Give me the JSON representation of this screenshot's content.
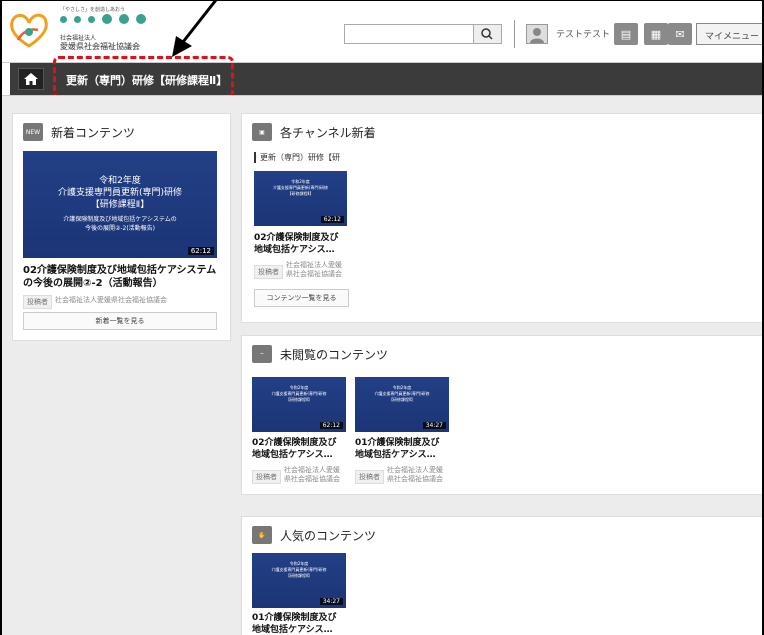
{
  "header": {
    "logo_tagline": "「やさしさ」を創造しあおう",
    "logo_org_type": "社会福祉法人",
    "logo_org_name": "愛媛県社会福祉協議会",
    "search_placeholder": "",
    "user_name": "テストテスト",
    "my_menu_label": "マイメニュー"
  },
  "nav": {
    "title": "更新（専門）研修【研修課程Ⅱ】"
  },
  "new_contents": {
    "badge": "NEW",
    "heading": "新着コンテンツ",
    "thumb_line1": "令和2年度",
    "thumb_line2": "介護支援専門員更新(専門)研修",
    "thumb_line3": "【研修課程Ⅱ】",
    "thumb_line4": "介護保険制度及び地域包括ケアシステムの",
    "thumb_line5": "今後の展開②-2(活動報告)",
    "duration": "62:12",
    "title": "02介護保険制度及び地域包括ケアシステムの今後の展開②-2（活動報告）",
    "poster_label": "投稿者",
    "poster_org": "社会福祉法人愛媛県社会福祉協議会",
    "more_label": "新着一覧を見る"
  },
  "channel_new": {
    "heading": "各チャンネル新着",
    "subheading": "更新（専門）研修【研",
    "item": {
      "thumb_line1": "令和2年度",
      "thumb_line2": "介護支援専門員更新(専門)研修",
      "thumb_line3": "【研修課程Ⅱ】",
      "duration": "62:12",
      "title_line1": "02介護保険制度及び",
      "title_line2": "地域包括ケアシス…",
      "poster_label": "投稿者",
      "poster_org_line1": "社会福祉法人愛媛",
      "poster_org_line2": "県社会福祉協議会"
    },
    "more_label": "コンテンツ一覧を見る"
  },
  "unviewed": {
    "heading": "未閲覧のコンテンツ",
    "items": [
      {
        "thumb_line1": "令和2年度",
        "thumb_line2": "介護支援専門員更新(専門)研修",
        "thumb_line3": "【研修課程Ⅱ】",
        "duration": "62:12",
        "title_line1": "02介護保険制度及び",
        "title_line2": "地域包括ケアシス…",
        "poster_label": "投稿者",
        "poster_org_line1": "社会福祉法人愛媛",
        "poster_org_line2": "県社会福祉協議会"
      },
      {
        "thumb_line1": "令和2年度",
        "thumb_line2": "介護支援専門員更新(専門)研修",
        "thumb_line3": "【研修課程Ⅱ】",
        "duration": "34:27",
        "title_line1": "01介護保険制度及び",
        "title_line2": "地域包括ケアシス…",
        "poster_label": "投稿者",
        "poster_org_line1": "社会福祉法人愛媛",
        "poster_org_line2": "県社会福祉協議会"
      }
    ]
  },
  "popular": {
    "heading": "人気のコンテンツ",
    "item": {
      "thumb_line1": "令和2年度",
      "thumb_line2": "介護支援専門員更新(専門)研修",
      "thumb_line3": "【研修課程Ⅱ】",
      "duration": "34:27",
      "title_line1": "01介護保険制度及び",
      "title_line2": "地域包括ケアシス…"
    }
  },
  "colors": {
    "nav_bg": "#3b3b3b",
    "thumb_bg": "#233f86",
    "logo_green": "#3aa08f",
    "highlight": "#e0101a"
  }
}
